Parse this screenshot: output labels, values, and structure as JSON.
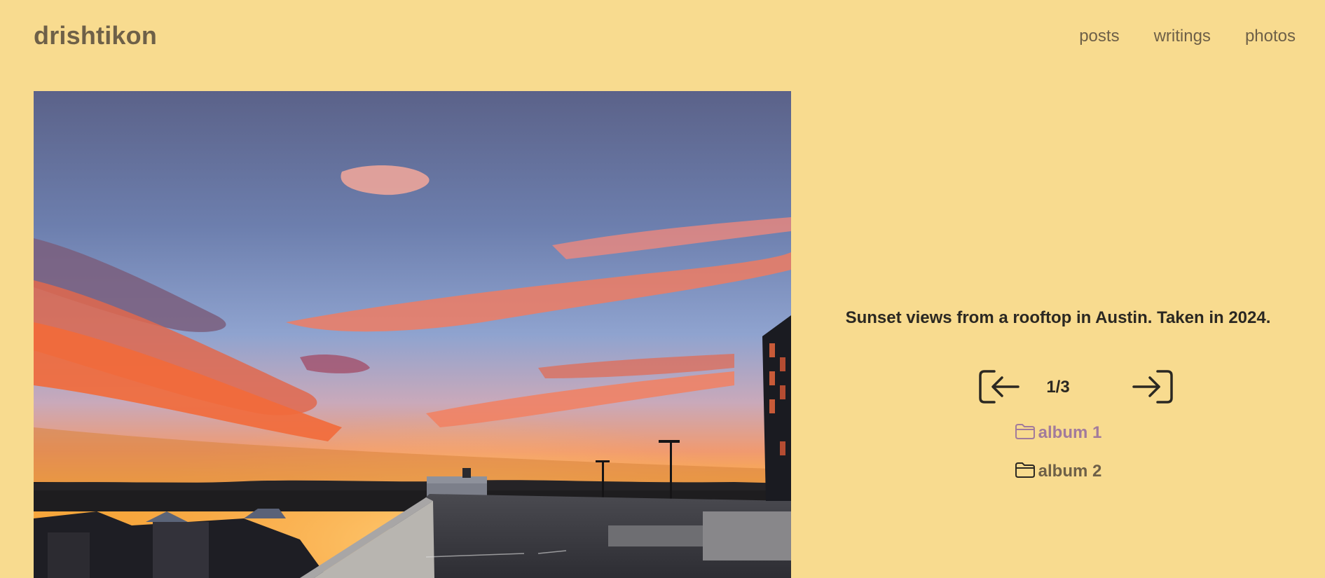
{
  "site": {
    "brand": "drishtikon"
  },
  "nav": {
    "items": [
      {
        "label": "posts"
      },
      {
        "label": "writings"
      },
      {
        "label": "photos"
      }
    ]
  },
  "gallery": {
    "photo_alt": "Sunset over a rooftop parking deck",
    "caption": "Sunset views from a rooftop in Austin. Taken in 2024.",
    "counter": "1/3",
    "prev_icon": "arrow-left-enter-icon",
    "next_icon": "arrow-right-enter-icon"
  },
  "albums": [
    {
      "label": "album 1",
      "icon": "folder-icon",
      "color": "#a27b9c"
    },
    {
      "label": "album 2",
      "icon": "folder-icon",
      "color": "#6e6048"
    }
  ],
  "colors": {
    "background": "#f8db8f",
    "brand_text": "#6e6048",
    "body_text": "#2b2822",
    "album_accent": "#a27b9c"
  }
}
